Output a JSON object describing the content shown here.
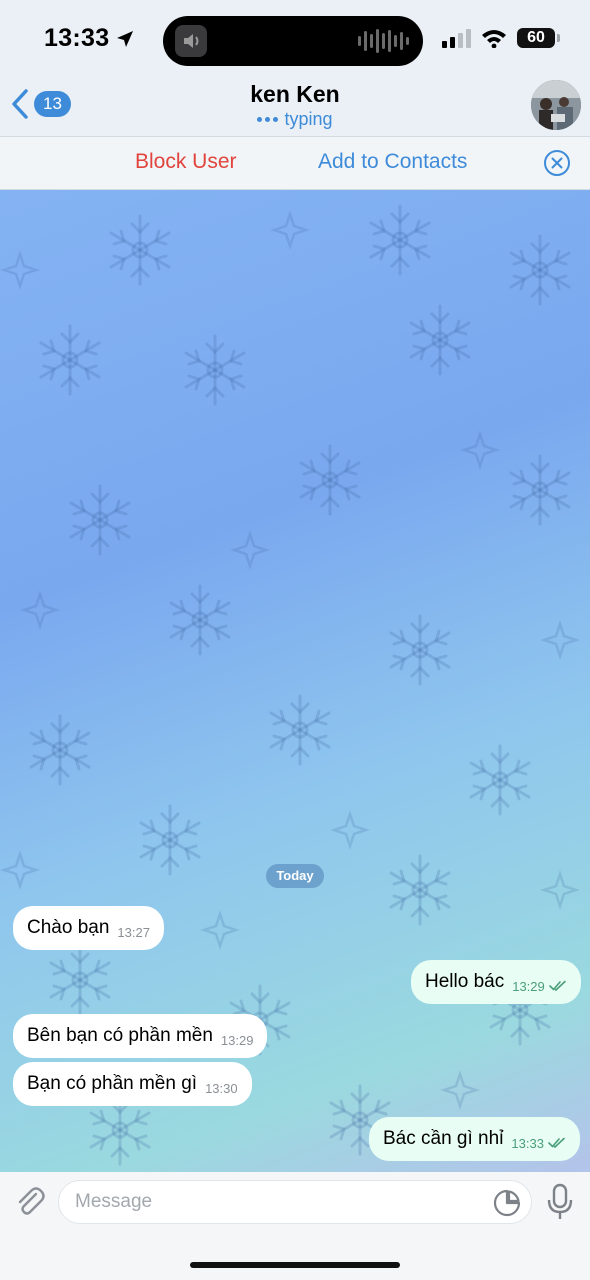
{
  "status_bar": {
    "time": "13:33",
    "battery": "60"
  },
  "header": {
    "back_count": "13",
    "title": "ken Ken",
    "status": "typing"
  },
  "action_bar": {
    "block_label": "Block User",
    "add_label": "Add to Contacts"
  },
  "chat": {
    "date_label": "Today",
    "messages": [
      {
        "direction": "in",
        "text": "Chào bạn",
        "time": "13:27"
      },
      {
        "direction": "out",
        "text": "Hello bác",
        "time": "13:29"
      },
      {
        "direction": "in",
        "text": "Bên bạn có phần mền",
        "time": "13:29"
      },
      {
        "direction": "in",
        "text": "Bạn có phần mền gì",
        "time": "13:30"
      },
      {
        "direction": "out",
        "text": "Bác cần gì nhỉ",
        "time": "13:33"
      }
    ]
  },
  "composer": {
    "placeholder": "Message"
  },
  "icons": [
    "location-arrow-icon",
    "speaker-icon",
    "signal-icon",
    "wifi-icon",
    "battery-icon",
    "back-chevron-icon",
    "close-circle-icon",
    "paperclip-icon",
    "sticker-icon",
    "mic-icon",
    "double-check-icon"
  ],
  "colors": {
    "accent": "#3e8bd9",
    "danger": "#e0443c",
    "outgoing_bubble": "#e8fdf3",
    "incoming_bubble": "#ffffff"
  }
}
